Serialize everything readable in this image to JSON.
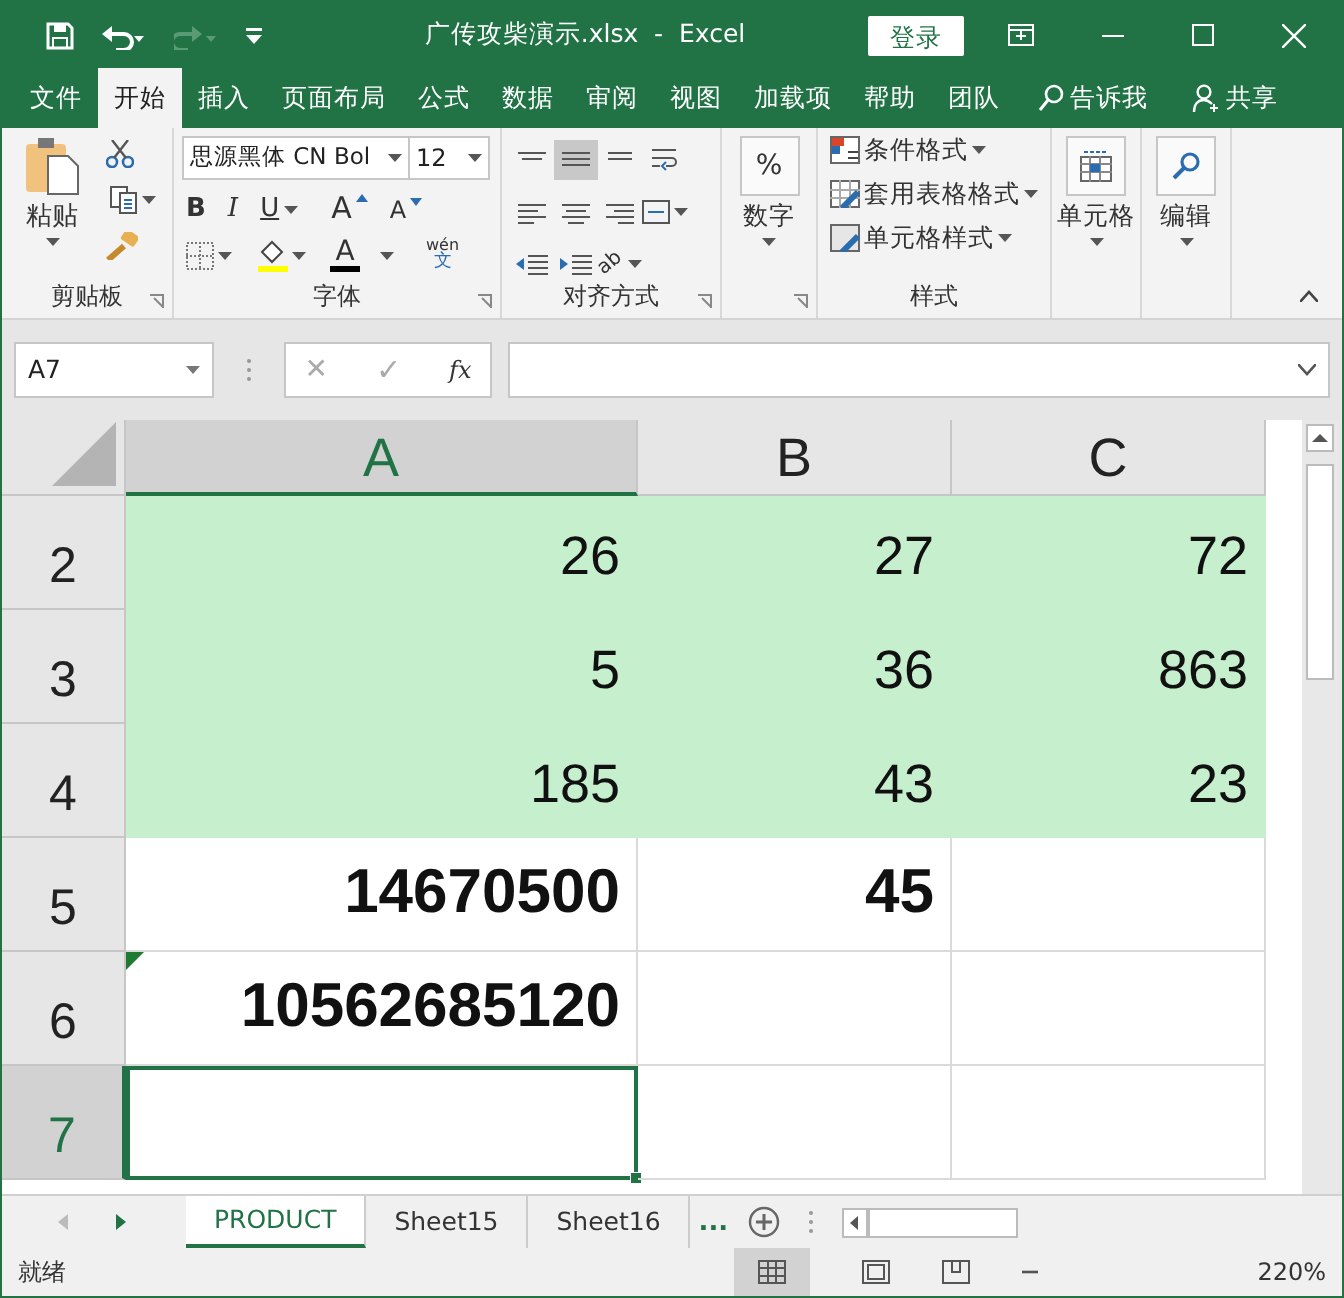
{
  "title_bar": {
    "title": "广传攻柴演示.xlsx  -  Excel",
    "login": "登录"
  },
  "ribbon_tabs": [
    {
      "label": "文件",
      "selected": false
    },
    {
      "label": "开始",
      "selected": true
    },
    {
      "label": "插入",
      "selected": false
    },
    {
      "label": "页面布局",
      "selected": false
    },
    {
      "label": "公式",
      "selected": false
    },
    {
      "label": "数据",
      "selected": false
    },
    {
      "label": "审阅",
      "selected": false
    },
    {
      "label": "视图",
      "selected": false
    },
    {
      "label": "加载项",
      "selected": false
    },
    {
      "label": "帮助",
      "selected": false
    },
    {
      "label": "团队",
      "selected": false
    }
  ],
  "tell_me": "告诉我",
  "share": "共享",
  "ribbon": {
    "clipboard": {
      "paste": "粘贴",
      "group": "剪贴板"
    },
    "font": {
      "font_name": "思源黑体 CN Bol",
      "font_size": "12",
      "bold": "B",
      "italic": "I",
      "underline": "U",
      "grow": "A",
      "shrink": "A",
      "font_color": "A",
      "phonetic": "wén",
      "phonetic_char": "文",
      "group": "字体"
    },
    "alignment": {
      "orientation": "ab",
      "group": "对齐方式"
    },
    "number": {
      "symbol": "%",
      "label": "数字"
    },
    "styles": {
      "items": [
        "条件格式",
        "套用表格格式",
        "单元格样式"
      ],
      "group": "样式"
    },
    "cells": {
      "label": "单元格"
    },
    "editing": {
      "label": "编辑"
    }
  },
  "formula_bar": {
    "name_box": "A7",
    "cancel": "✕",
    "enter": "✓",
    "fx": "fx"
  },
  "columns": [
    {
      "label": "A",
      "selected": true
    },
    {
      "label": "B",
      "selected": false
    },
    {
      "label": "C",
      "selected": false
    }
  ],
  "rows": [
    {
      "number": "2",
      "selected": false,
      "highlighted": true,
      "bold": false,
      "cells": [
        {
          "text": "26"
        },
        {
          "text": "27"
        },
        {
          "text": "72"
        }
      ]
    },
    {
      "number": "3",
      "selected": false,
      "highlighted": true,
      "bold": false,
      "cells": [
        {
          "text": "5"
        },
        {
          "text": "36"
        },
        {
          "text": "863"
        }
      ]
    },
    {
      "number": "4",
      "selected": false,
      "highlighted": true,
      "bold": false,
      "cells": [
        {
          "text": "185"
        },
        {
          "text": "43"
        },
        {
          "text": "23"
        }
      ]
    },
    {
      "number": "5",
      "selected": false,
      "highlighted": false,
      "bold": true,
      "cells": [
        {
          "text": "14670500"
        },
        {
          "text": "45"
        },
        {
          "text": ""
        }
      ]
    },
    {
      "number": "6",
      "selected": false,
      "highlighted": false,
      "bold": true,
      "cells": [
        {
          "text": "10562685120",
          "error_flag": true
        },
        {
          "text": ""
        },
        {
          "text": ""
        }
      ]
    },
    {
      "number": "7",
      "selected": true,
      "highlighted": false,
      "bold": false,
      "cells": [
        {
          "text": "",
          "active": true
        },
        {
          "text": ""
        },
        {
          "text": ""
        }
      ]
    }
  ],
  "sheet_tabs": [
    {
      "label": "PRODUCT",
      "selected": true
    },
    {
      "label": "Sheet15",
      "selected": false
    },
    {
      "label": "Sheet16",
      "selected": false
    }
  ],
  "more_sheets": "...",
  "status_bar": {
    "status": "就绪",
    "zoom": "220%"
  }
}
